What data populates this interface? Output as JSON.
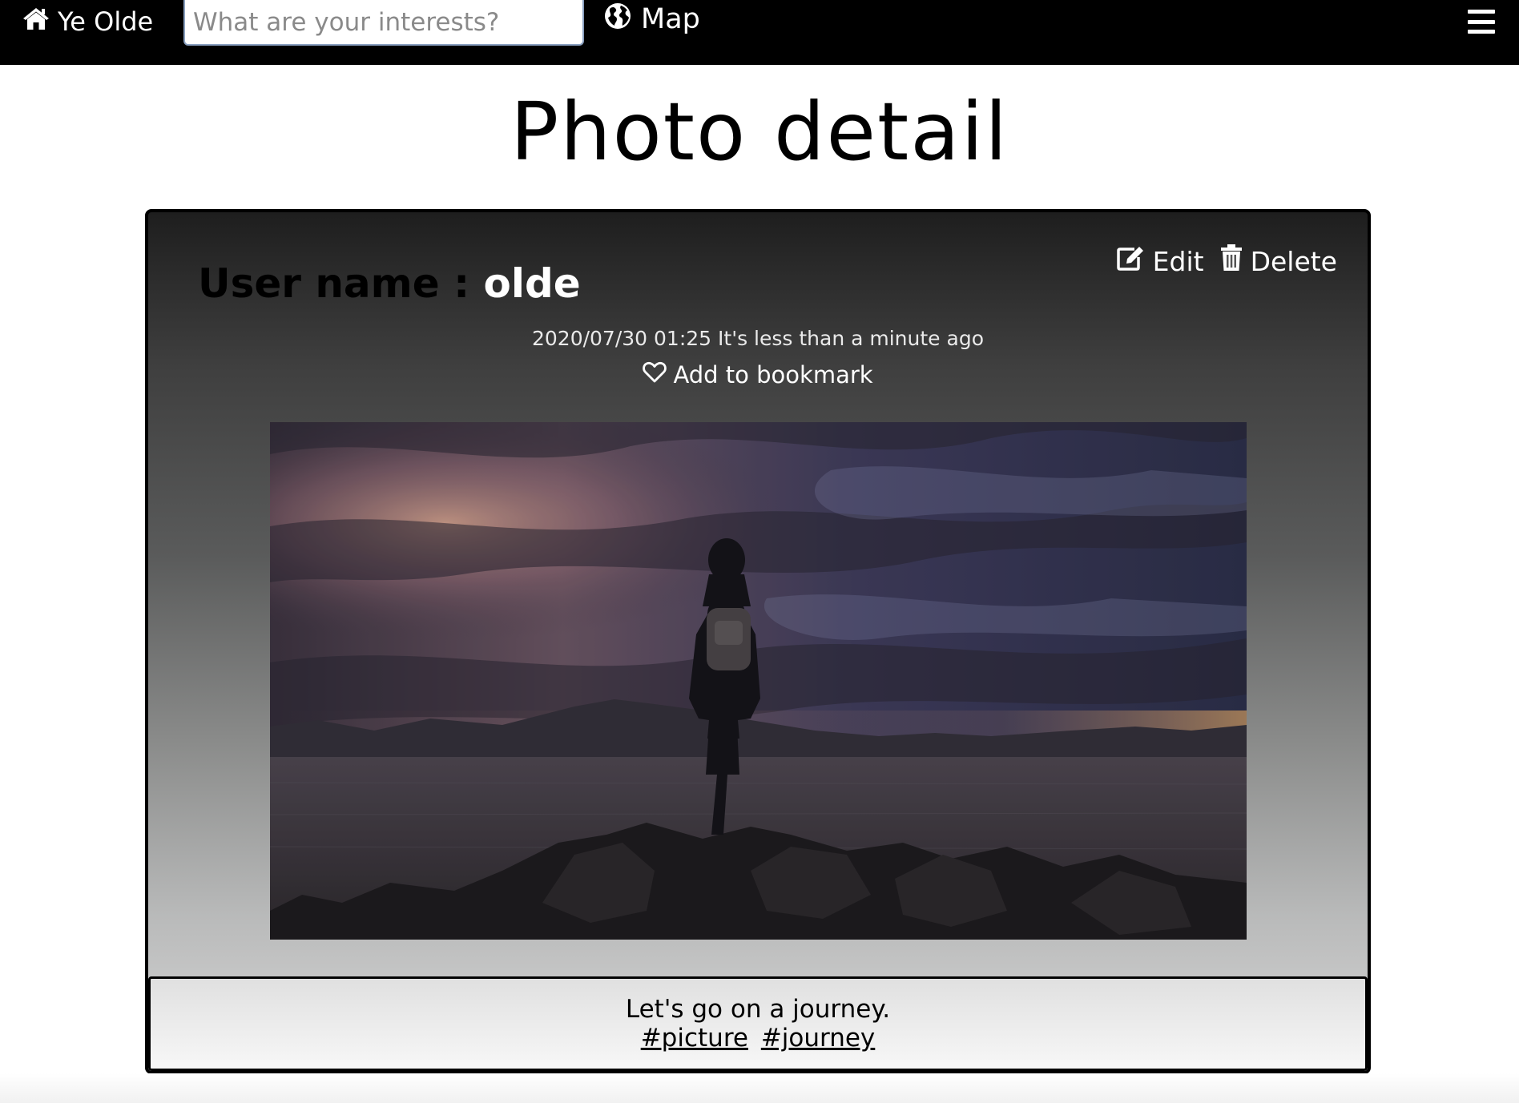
{
  "nav": {
    "brand_label": "Ye Olde",
    "search_placeholder": "What are your interests?",
    "map_label": "Map"
  },
  "page": {
    "title": "Photo detail"
  },
  "post": {
    "user_label": "User name : ",
    "user_name": "olde",
    "timestamp": "2020/07/30 01:25 It's less than a minute ago",
    "bookmark_label": "Add to bookmark",
    "edit_label": "Edit",
    "delete_label": "Delete",
    "caption": "Let's go on a journey.",
    "tags": [
      "#picture",
      "#journey"
    ]
  },
  "icons": {
    "brand": "home-icon",
    "map": "globe-icon",
    "menu": "hamburger-menu-icon",
    "edit": "edit-icon",
    "delete": "trash-icon",
    "bookmark": "heart-outline-icon"
  }
}
